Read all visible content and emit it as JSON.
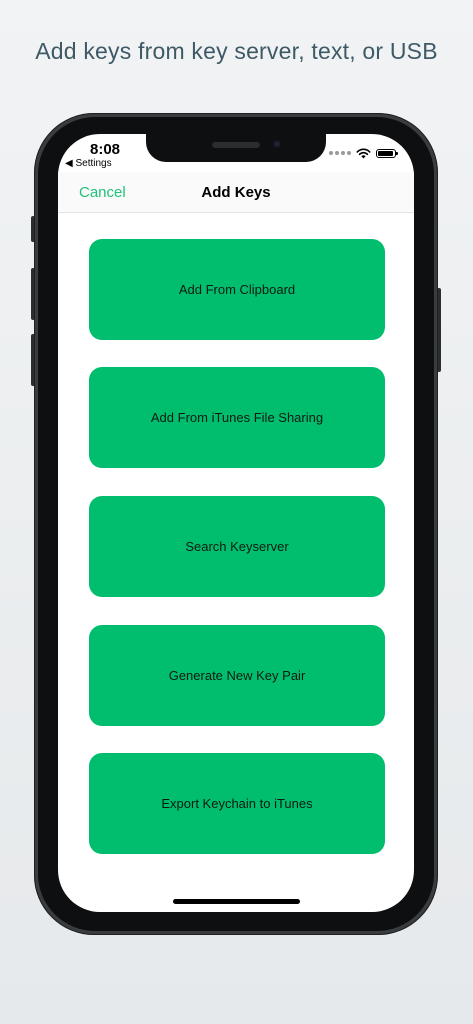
{
  "headline": "Add keys from key server, text, or USB",
  "status_bar": {
    "time": "8:08",
    "back_label": "Settings",
    "icons": [
      "signal-dots-icon",
      "wifi-icon",
      "battery-icon"
    ]
  },
  "navbar": {
    "cancel_label": "Cancel",
    "title": "Add Keys"
  },
  "actions": [
    {
      "label": "Add From Clipboard"
    },
    {
      "label": "Add From iTunes File Sharing"
    },
    {
      "label": "Search Keyserver"
    },
    {
      "label": "Generate New Key Pair"
    },
    {
      "label": "Export Keychain to iTunes"
    }
  ],
  "colors": {
    "accent": "#1fc279",
    "button": "#00be6e",
    "headline": "#3e5a66"
  }
}
